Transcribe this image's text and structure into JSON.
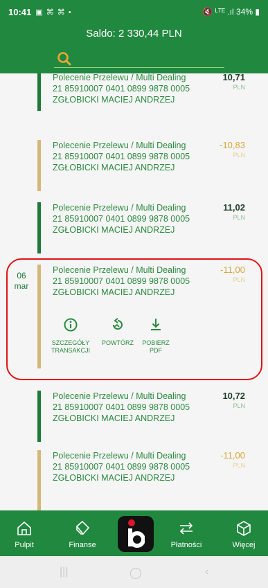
{
  "status_bar": {
    "time": "10:41",
    "left_icons": "▣ ⌘ ⌘ •",
    "right": "🔇 ᴸᵀᴱ .ıl 34% ▮"
  },
  "header": {
    "saldo": "Saldo: 2 330,44 PLN",
    "search_icon": "search-icon"
  },
  "transactions": [
    {
      "line1": "Polecenie Przelewu / Multi Dealing",
      "line2": "21 85910007 0401 0899 9878 0005",
      "line3": "ZGŁOBICKI MACIEJ ANDRZEJ",
      "amount": "10,71",
      "currency": "PLN",
      "type": "pos"
    },
    {
      "line1": "Polecenie Przelewu / Multi Dealing",
      "line2": "21 85910007 0401 0899 9878 0005",
      "line3": "ZGŁOBICKI MACIEJ ANDRZEJ",
      "amount": "-10,83",
      "currency": "PLN",
      "type": "neg"
    },
    {
      "line1": "Polecenie Przelewu / Multi Dealing",
      "line2": "21 85910007 0401 0899 9878 0005",
      "line3": "ZGŁOBICKI MACIEJ ANDRZEJ",
      "amount": "11,02",
      "currency": "PLN",
      "type": "pos"
    },
    {
      "line1": "Polecenie Przelewu / Multi Dealing",
      "line2": "21 85910007 0401 0899 9878 0005",
      "line3": "ZGŁOBICKI MACIEJ ANDRZEJ",
      "amount": "-11,00",
      "currency": "PLN",
      "type": "neg",
      "date_day": "06",
      "date_month": "mar",
      "actions": [
        {
          "label1": "SZCZEGÓŁY",
          "label2": "TRANSAKCJI",
          "icon": "info-icon"
        },
        {
          "label1": "POWTÓRZ",
          "label2": "",
          "icon": "repeat-icon"
        },
        {
          "label1": "POBIERZ",
          "label2": "PDF",
          "icon": "download-icon"
        }
      ]
    },
    {
      "line1": "Polecenie Przelewu / Multi Dealing",
      "line2": "21 85910007 0401 0899 9878 0005",
      "line3": "ZGŁOBICKI MACIEJ ANDRZEJ",
      "amount": "10,72",
      "currency": "PLN",
      "type": "pos"
    },
    {
      "line1": "Polecenie Przelewu / Multi Dealing",
      "line2": "21 85910007 0401 0899 9878 0005",
      "line3": "ZGŁOBICKI MACIEJ ANDRZEJ",
      "amount": "-11,00",
      "currency": "PLN",
      "type": "neg"
    }
  ],
  "bottom_nav": [
    {
      "label": "Pulpit",
      "icon": "home-icon"
    },
    {
      "label": "Finanse",
      "icon": "tag-icon"
    },
    {
      "label": "",
      "icon": "bank-logo-icon"
    },
    {
      "label": "Płatności",
      "icon": "transfer-arrows-icon"
    },
    {
      "label": "Więcej",
      "icon": "cube-icon"
    }
  ],
  "colors": {
    "brand_green": "#21883f",
    "positive_bar": "#1f7a3a",
    "negative_bar": "#d6b77a",
    "negative_amount": "#d6a53b",
    "highlight": "#e11414"
  }
}
